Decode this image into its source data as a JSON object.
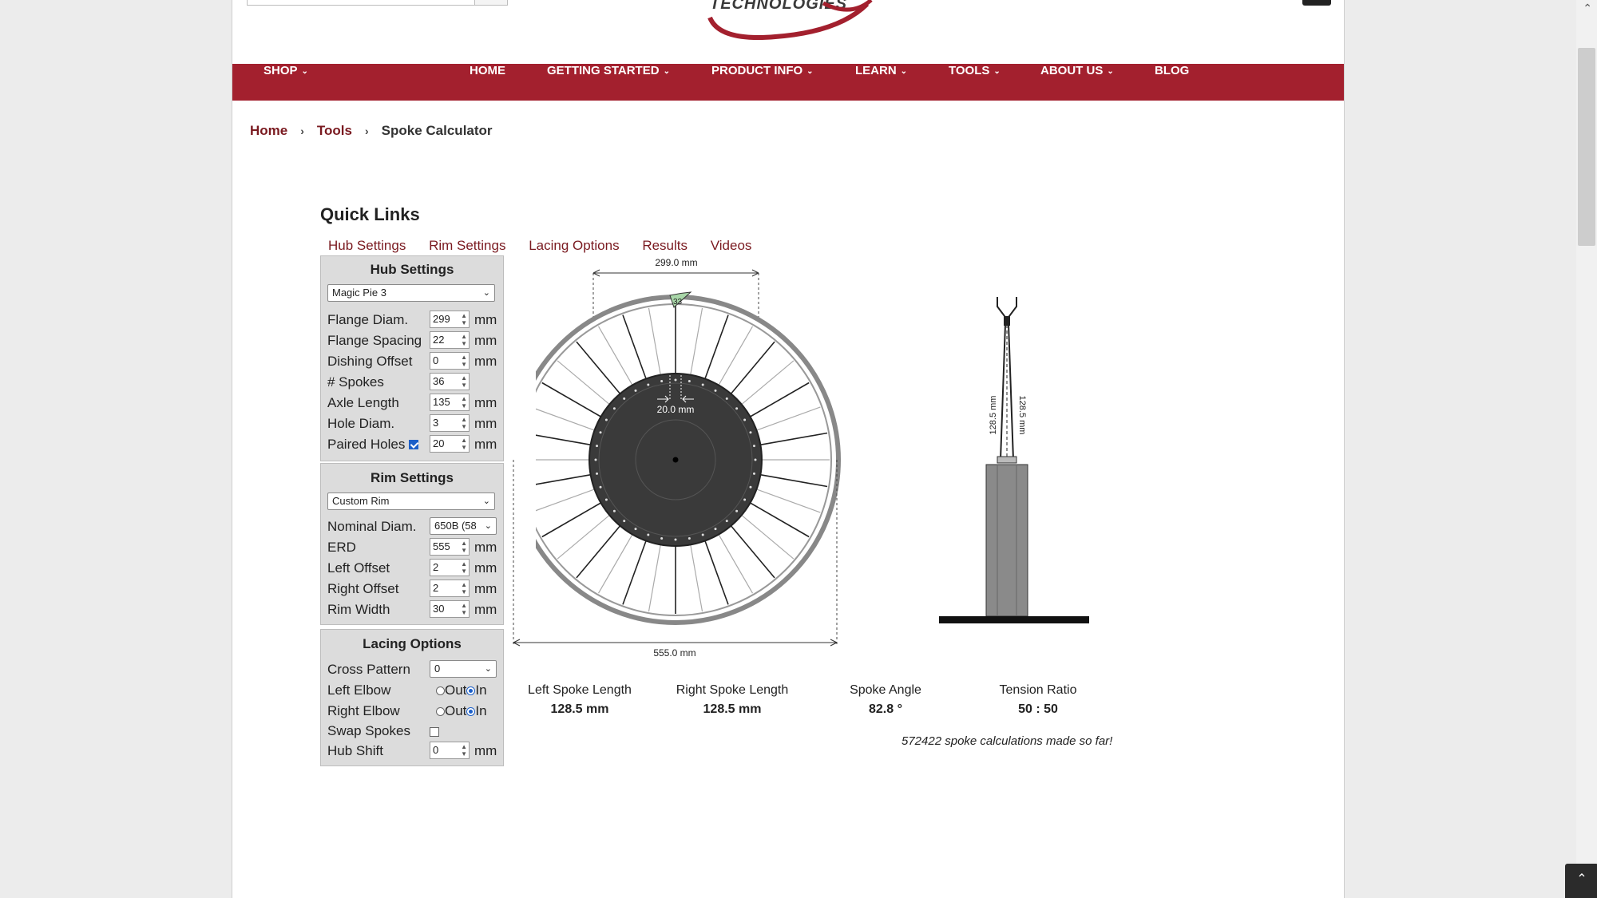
{
  "header": {
    "logo_text": "TECHNOLOGIES"
  },
  "nav": {
    "items": [
      {
        "label": "SHOP",
        "dropdown": true
      },
      {
        "label": "HOME",
        "dropdown": false
      },
      {
        "label": "GETTING STARTED",
        "dropdown": true
      },
      {
        "label": "PRODUCT INFO",
        "dropdown": true
      },
      {
        "label": "LEARN",
        "dropdown": true
      },
      {
        "label": "TOOLS",
        "dropdown": true
      },
      {
        "label": "ABOUT US",
        "dropdown": true
      },
      {
        "label": "BLOG",
        "dropdown": false
      }
    ]
  },
  "breadcrumb": {
    "home": "Home",
    "tools": "Tools",
    "current": "Spoke Calculator"
  },
  "quick_links": {
    "title": "Quick Links",
    "links": [
      "Hub Settings",
      "Rim Settings",
      "Lacing Options",
      "Results",
      "Videos"
    ]
  },
  "hub_settings": {
    "title": "Hub Settings",
    "hub_select": "Magic Pie 3",
    "flange_diam": {
      "label": "Flange Diam.",
      "value": "299",
      "unit": "mm"
    },
    "flange_spacing": {
      "label": "Flange Spacing",
      "value": "22",
      "unit": "mm"
    },
    "dishing_offset": {
      "label": "Dishing Offset",
      "value": "0",
      "unit": "mm"
    },
    "spokes": {
      "label": "# Spokes",
      "value": "36"
    },
    "axle_length": {
      "label": "Axle Length",
      "value": "135",
      "unit": "mm"
    },
    "hole_diam": {
      "label": "Hole Diam.",
      "value": "3",
      "unit": "mm"
    },
    "paired_holes": {
      "label": "Paired Holes",
      "checked": true,
      "value": "20",
      "unit": "mm"
    }
  },
  "rim_settings": {
    "title": "Rim Settings",
    "rim_select": "Custom Rim",
    "nominal_diam": {
      "label": "Nominal Diam.",
      "value": "650B (58"
    },
    "erd": {
      "label": "ERD",
      "value": "555",
      "unit": "mm"
    },
    "left_offset": {
      "label": "Left Offset",
      "value": "2",
      "unit": "mm"
    },
    "right_offset": {
      "label": "Right Offset",
      "value": "2",
      "unit": "mm"
    },
    "rim_width": {
      "label": "Rim Width",
      "value": "30",
      "unit": "mm"
    }
  },
  "lacing_options": {
    "title": "Lacing Options",
    "cross_pattern": {
      "label": "Cross Pattern",
      "value": "0"
    },
    "left_elbow": {
      "label": "Left Elbow",
      "out": "Out",
      "in": "In",
      "selected": "In"
    },
    "right_elbow": {
      "label": "Right Elbow",
      "out": "Out",
      "in": "In",
      "selected": "In"
    },
    "swap_spokes": {
      "label": "Swap Spokes",
      "checked": false
    },
    "hub_shift": {
      "label": "Hub Shift",
      "value": "0",
      "unit": "mm"
    }
  },
  "diagram": {
    "flange_dim": "299.0 mm",
    "erd_dim": "555.0 mm",
    "spacing_dim": "20.0 mm",
    "spoke_marker": "33",
    "left_len_dim": "128.5 mm",
    "right_len_dim": "128.5 mm"
  },
  "results": {
    "left_spoke_length": {
      "label": "Left Spoke Length",
      "value": "128.5 mm"
    },
    "right_spoke_length": {
      "label": "Right Spoke Length",
      "value": "128.5 mm"
    },
    "spoke_angle": {
      "label": "Spoke Angle",
      "value": "82.8 °"
    },
    "tension_ratio": {
      "label": "Tension Ratio",
      "value": "50 : 50"
    },
    "counter": "572422 spoke calculations made so far!"
  },
  "colors": {
    "brand_red": "#a3202e",
    "link_red": "#7a1a20",
    "panel_gray": "#dcdcdc",
    "hub_dark": "#3a3a3a"
  }
}
